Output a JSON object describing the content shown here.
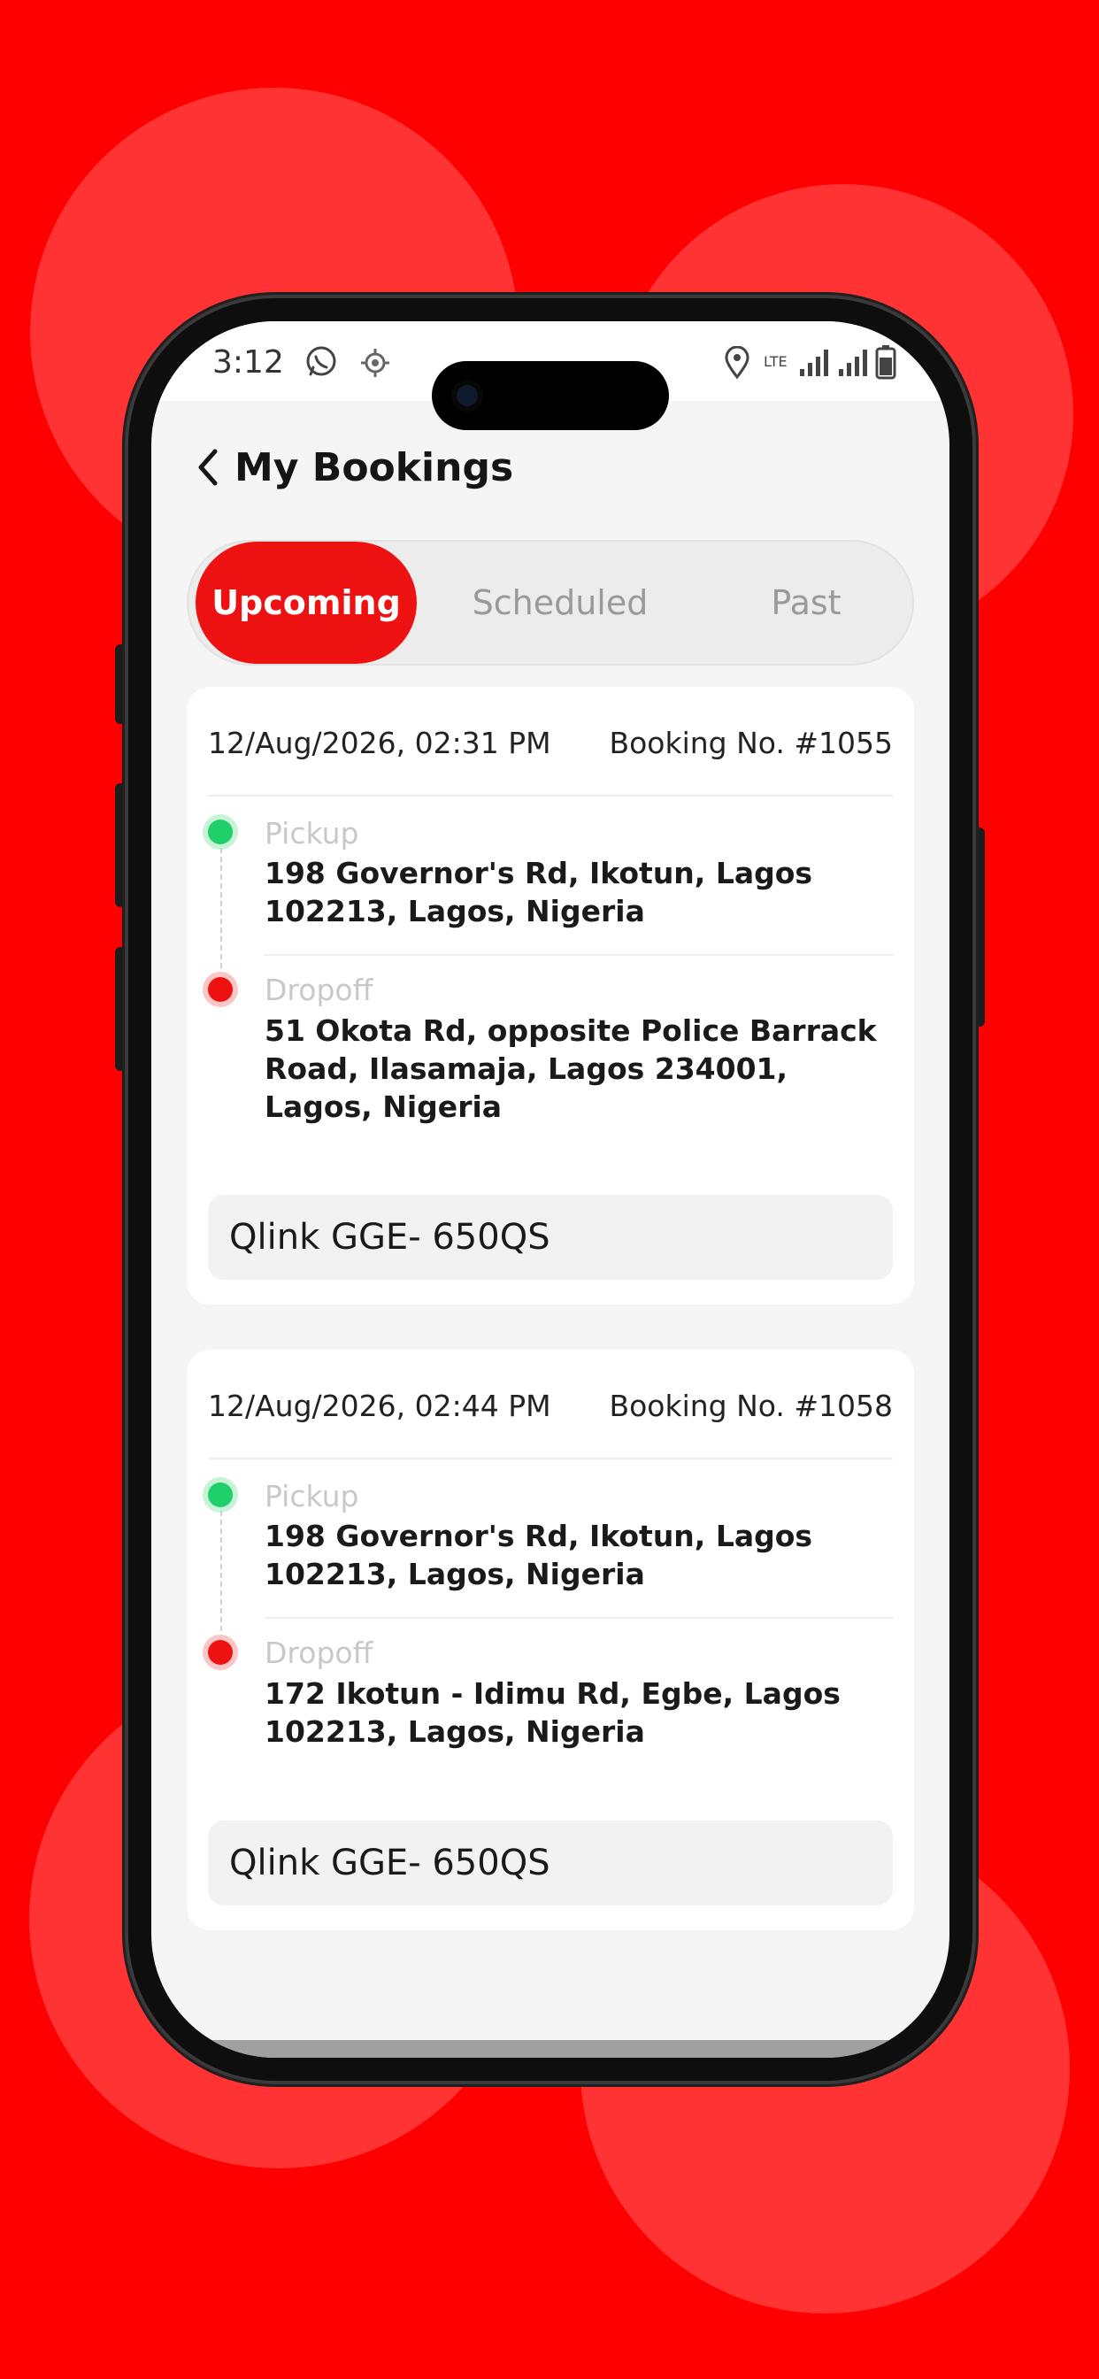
{
  "status_bar": {
    "time": "3:12",
    "network": "LTE",
    "icons": [
      "whatsapp-icon",
      "location-target-icon",
      "map-pin-icon",
      "signal-icon",
      "signal-icon",
      "battery-icon"
    ]
  },
  "header": {
    "back_icon": "chevron-left-icon",
    "title": "My Bookings"
  },
  "tabs": [
    {
      "label": "Upcoming",
      "active": true
    },
    {
      "label": "Scheduled",
      "active": false
    },
    {
      "label": "Past",
      "active": false
    }
  ],
  "bookings": [
    {
      "datetime": "12/Aug/2026, 02:31 PM",
      "booking_no": "Booking No. #1055",
      "pickup_label": "Pickup",
      "pickup_address": "198 Governor's Rd, Ikotun, Lagos 102213, Lagos, Nigeria",
      "dropoff_label": "Dropoff",
      "dropoff_address": "51 Okota Rd, opposite Police Barrack Road, Ilasamaja, Lagos 234001, Lagos, Nigeria",
      "vehicle": "Qlink GGE- 650QS"
    },
    {
      "datetime": "12/Aug/2026, 02:44 PM",
      "booking_no": "Booking No. #1058",
      "pickup_label": "Pickup",
      "pickup_address": "198 Governor's Rd, Ikotun, Lagos 102213, Lagos, Nigeria",
      "dropoff_label": "Dropoff",
      "dropoff_address": "172 Ikotun - Idimu Rd, Egbe, Lagos 102213, Lagos, Nigeria",
      "vehicle": "Qlink GGE- 650QS"
    }
  ],
  "colors": {
    "background": "#ff0000",
    "accent": "#ee1111",
    "pickup_dot": "#1fcf6a",
    "dropoff_dot": "#ee1111"
  }
}
